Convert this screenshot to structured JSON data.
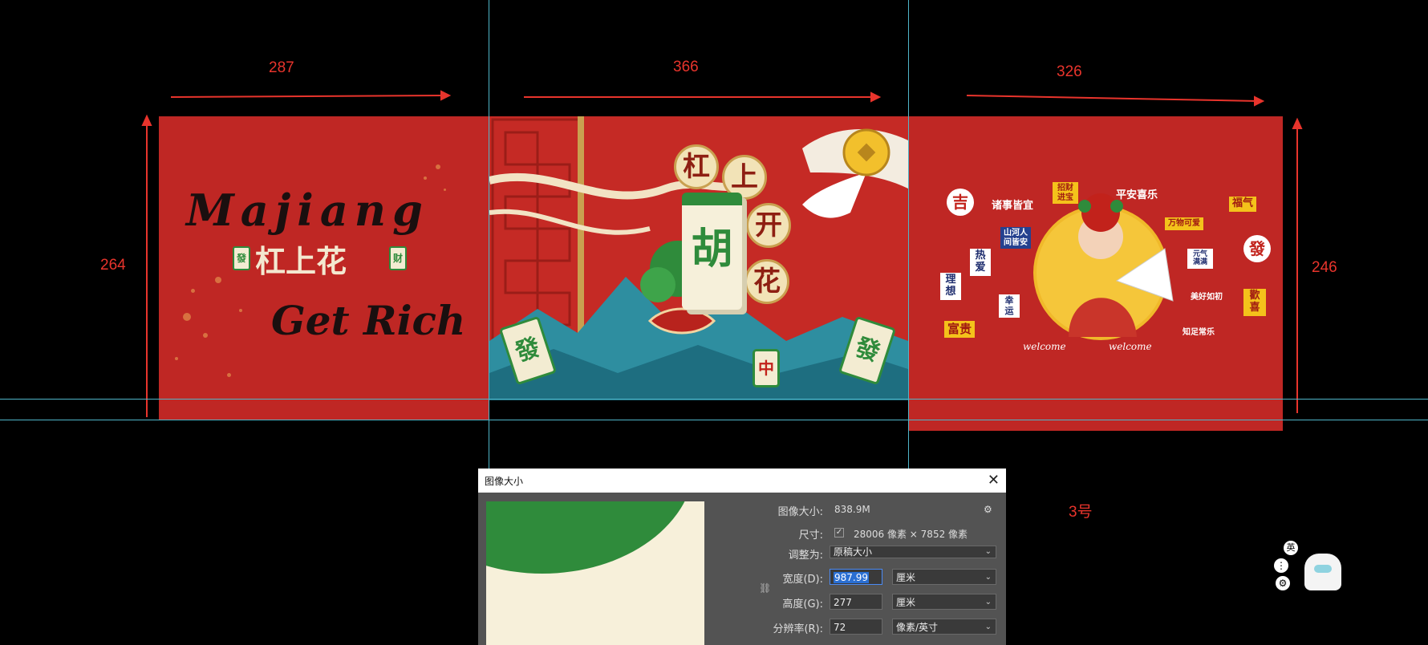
{
  "dimensions": {
    "w1": "287",
    "w2": "366",
    "w3": "326",
    "h_left": "264",
    "h_right": "246",
    "label_no": "3号"
  },
  "left_panel": {
    "line1": "Majiang",
    "line2": "杠上花",
    "line3": "Get Rich",
    "tile_left": "發",
    "tile_right": "财"
  },
  "middle_panel": {
    "disc_1": "杠",
    "disc_2": "上",
    "disc_3": "开",
    "disc_4": "花",
    "main_tile": "胡",
    "tile_fa_left": "發",
    "tile_fa_right": "發",
    "tile_zhong": "中"
  },
  "right_panel": {
    "s_ji": "吉",
    "s_zhuishi": "诸事皆宜",
    "s_zhaocai": "招财进宝",
    "s_pingan": "平安喜乐",
    "s_wanwu": "万物可爱",
    "s_fuqi": "福气",
    "s_fa": "發",
    "s_shanhe": "山河人间皆安",
    "s_reai": "热爱",
    "s_lixiang": "理想",
    "s_xingyun": "幸运",
    "s_fugui": "富贵",
    "s_yuanqi": "元气满满",
    "s_meihao": "美好如初",
    "s_huanxi": "歡喜",
    "s_zhizu": "知足常乐",
    "welcome_1": "welcome",
    "welcome_2": "welcome"
  },
  "dialog": {
    "title": "图像大小",
    "close": "✕",
    "image_size_label": "图像大小:",
    "image_size_value": "838.9M",
    "dimensions_label": "尺寸:",
    "dimensions_value": "28006 像素 × 7852 像素",
    "fit_label": "调整为:",
    "fit_value": "原稿大小",
    "width_label": "宽度(D):",
    "width_value": "987.99",
    "width_unit": "厘米",
    "height_label": "高度(G):",
    "height_value": "277",
    "height_unit": "厘米",
    "res_label": "分辨率(R):",
    "res_value": "72",
    "res_unit": "像素/英寸",
    "chevron": "⌄",
    "check_mark": "✓",
    "gear": "⚙",
    "link": "⛓"
  },
  "widget": {
    "lang": "英",
    "dots": "⋮",
    "settings": "⚙"
  }
}
